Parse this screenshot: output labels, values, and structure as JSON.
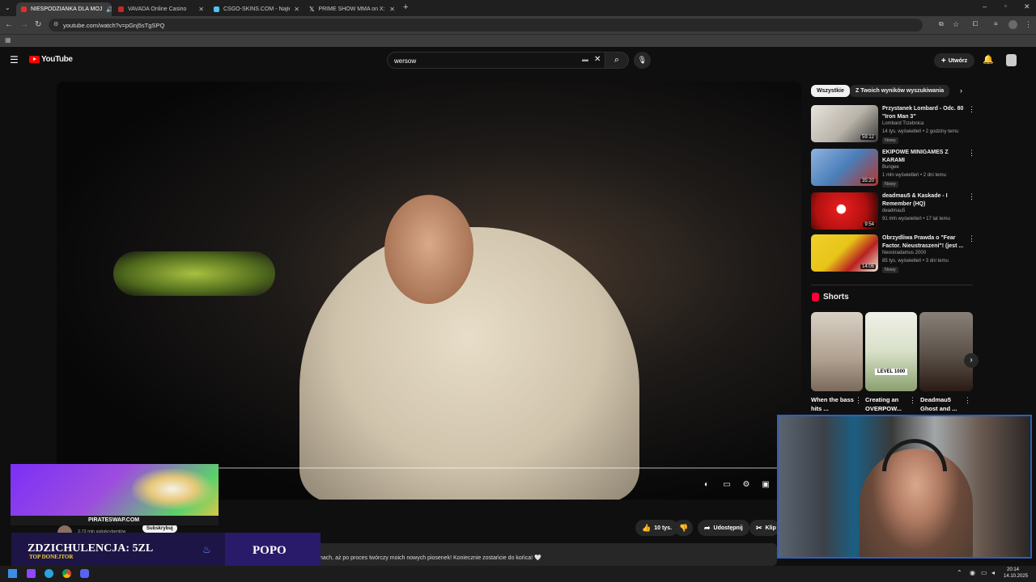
{
  "browser": {
    "tabs": [
      {
        "title": "NIESPODZIANKA DLA MOJ",
        "color": "#e52d27",
        "active": true
      },
      {
        "title": "VAVADA Online Casino",
        "color": "#c62828",
        "active": false
      },
      {
        "title": "CSGO-SKINS.COM - Najlepsze",
        "color": "#4fc3f7",
        "active": false
      },
      {
        "title": "PRIME SHOW MMA on X: \"MM",
        "color": "#ffffff",
        "active": false
      }
    ],
    "url": "youtube.com/watch?v=pGnj5sTgSPQ"
  },
  "youtube": {
    "logo_text": "YouTube",
    "search_value": "wersow",
    "create_label": "Utwórz"
  },
  "video": {
    "actions": {
      "likes": "10 tys.",
      "share_label": "Udostępnij",
      "clip_label": "Klip"
    },
    "channel_subs": "2,72 mln subskrybentów",
    "subscribe_label": "Subskrybuj",
    "description_line": "nach, aż po proces twórczy moich nowych piosenek! Koniecznie zostańcie do końca! 🤍"
  },
  "sidebar": {
    "chips": [
      "Wszystkie",
      "Z Twoich wyników wyszukiwania"
    ],
    "recommendations": [
      {
        "title": "Przystanek Lombard - Odc. 80 \"Iron Man 3\"",
        "channel": "Lombard Trzebnica",
        "meta": "14 tys. wyświetleń • 2 godziny temu",
        "badge": "Nowy",
        "duration": "59:12",
        "thumb_color": "#d8d2c8"
      },
      {
        "title": "EKIPOWE MINIGAMES Z KARAMI",
        "channel": "Bungee",
        "meta": "1 mln wyświetleń • 2 dni temu",
        "badge": "Nowy",
        "duration": "35:20",
        "thumb_color": "#4a7db8"
      },
      {
        "title": "deadmau5 & Kaskade - I Remember (HQ)",
        "channel": "deadmau5",
        "meta": "91 mln wyświetleń • 17 lat temu",
        "badge": "",
        "duration": "9:54",
        "thumb_color": "#d01818"
      },
      {
        "title": "Obrzydliwa Prawda o \"Fear Factor. Nieustraszeni\"! (jest ...",
        "channel": "Neostradamus 2000",
        "meta": "85 tys. wyświetleń • 3 dni temu",
        "badge": "Nowy",
        "duration": "14:06",
        "thumb_color": "#e6c418"
      }
    ],
    "shorts_heading": "Shorts",
    "shorts": [
      {
        "title": "When the bass hits ...",
        "color": "#b0a090"
      },
      {
        "title": "Creating an OVERPOW...",
        "color": "#d8e0c8",
        "label": "LEVEL 1000"
      },
      {
        "title": "Deadmau5 Ghost and ...",
        "color": "#5a5048"
      }
    ]
  },
  "overlays": {
    "promo_label": "PIRATESWAP.COM",
    "donor_title": "ZDZICHULENCJA: 5ZL",
    "donor_sub": "TOP DONEJTOR",
    "donor_name": "POPO"
  },
  "taskbar": {
    "time": "20:14",
    "date": "14.10.2025"
  }
}
